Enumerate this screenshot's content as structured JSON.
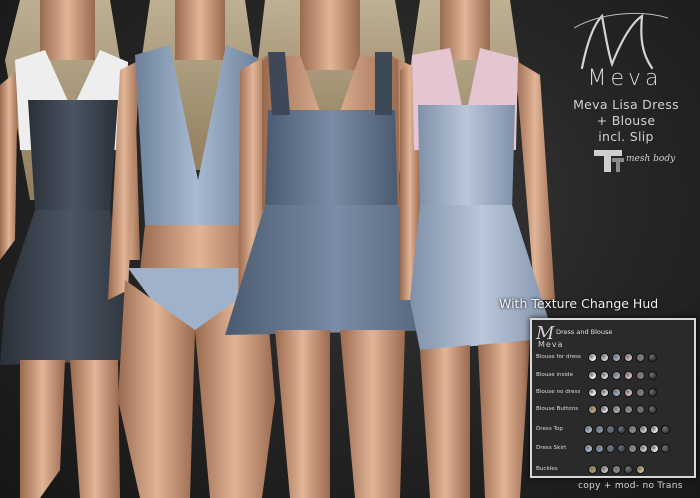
{
  "brand": {
    "name": "Meva",
    "line1": "Meva Lisa Dress",
    "line2": "+ Blouse",
    "line3": "incl. Slip",
    "mesh_label": "mesh body"
  },
  "hud_title": "With Texture Change Hud",
  "hud": {
    "brand": "Meva",
    "header": "Dress and Blouse",
    "rows": [
      {
        "label": "Blouse for dress",
        "swatches": [
          "#f0f0f0",
          "#cfd6de",
          "#9fb0c4",
          "#d8b9c4",
          "#7d7d7d",
          "#3a3a3a"
        ]
      },
      {
        "label": "Blouse inside",
        "swatches": [
          "#f0f0f0",
          "#cfd6de",
          "#9fb0c4",
          "#d8b9c4",
          "#7d7d7d",
          "#3a3a3a"
        ]
      },
      {
        "label": "Blouse no dress",
        "swatches": [
          "#f0f0f0",
          "#cfd6de",
          "#9fb0c4",
          "#d8b9c4",
          "#7d7d7d",
          "#3a3a3a"
        ]
      },
      {
        "label": "Blouse Buttons",
        "swatches": [
          "#c9a67a",
          "#d8d8d8",
          "#b0b0b0",
          "#8e8e8e",
          "#6a6a6a",
          "#3e3e3e"
        ]
      },
      {
        "label": "Dress Top",
        "swatches": [
          "#a9b8c9",
          "#7f93a8",
          "#58687c",
          "#3c4654",
          "#8e8e8e",
          "#c9c9c9",
          "#e8e8e8",
          "#454545"
        ]
      },
      {
        "label": "Dress Skirt",
        "swatches": [
          "#a9b8c9",
          "#7f93a8",
          "#58687c",
          "#3c4654",
          "#8e8e8e",
          "#c9c9c9",
          "#e8e8e8",
          "#454545"
        ]
      },
      {
        "label": "Buckles",
        "swatches": [
          "#b8975e",
          "#c0c0c0",
          "#8a8a8a",
          "#4a4a4a",
          "#d6b67a"
        ]
      }
    ]
  },
  "permissions": "copy + mod- no Trans"
}
